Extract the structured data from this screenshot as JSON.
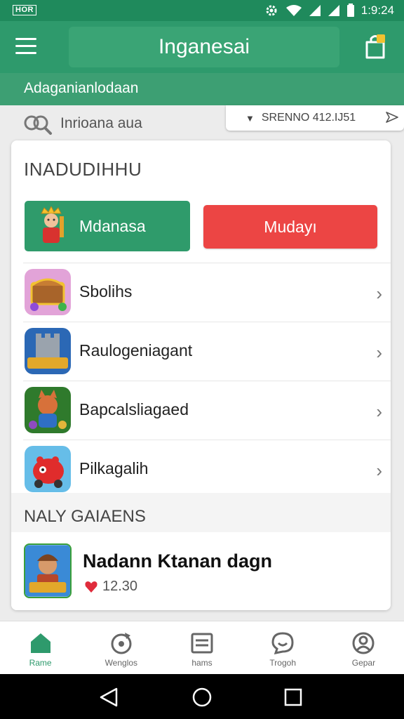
{
  "status_bar": {
    "tag": "HOR",
    "time": "1:9:24"
  },
  "app_bar": {
    "title": "Inganesai"
  },
  "subheader": {
    "text": "Adaganianlodaan"
  },
  "search": {
    "placeholder": "Inrioana aua",
    "filter_label": "SRENNO 412.IJ51"
  },
  "section": {
    "title": "INADUDIHHU"
  },
  "actions": {
    "green_label": "Mdanasa",
    "red_label": "Mudayı"
  },
  "games": [
    {
      "label": "Sbolihs",
      "icon": "treasure-chest-game-icon"
    },
    {
      "label": "Raulogeniagant",
      "icon": "castle-game-icon"
    },
    {
      "label": "Bapcalsliagaed",
      "icon": "fox-character-game-icon"
    },
    {
      "label": "Pilkagalih",
      "icon": "red-car-game-icon"
    }
  ],
  "new_games": {
    "title": "NALY GAIAENS",
    "item": {
      "name": "Nadann Ktanan dagn",
      "rating": "12.30",
      "icon": "hero-character-game-icon"
    }
  },
  "bottom_nav": [
    {
      "label": "Rame",
      "icon": "home-icon",
      "active": true
    },
    {
      "label": "Wenglos",
      "icon": "refresh-icon",
      "active": false
    },
    {
      "label": "hams",
      "icon": "list-icon",
      "active": false
    },
    {
      "label": "Trogoh",
      "icon": "chat-icon",
      "active": false
    },
    {
      "label": "Gepar",
      "icon": "profile-icon",
      "active": false
    }
  ],
  "colors": {
    "primary": "#2e9a6c",
    "danger": "#ec4544",
    "statusbar": "#1f8a5c"
  }
}
